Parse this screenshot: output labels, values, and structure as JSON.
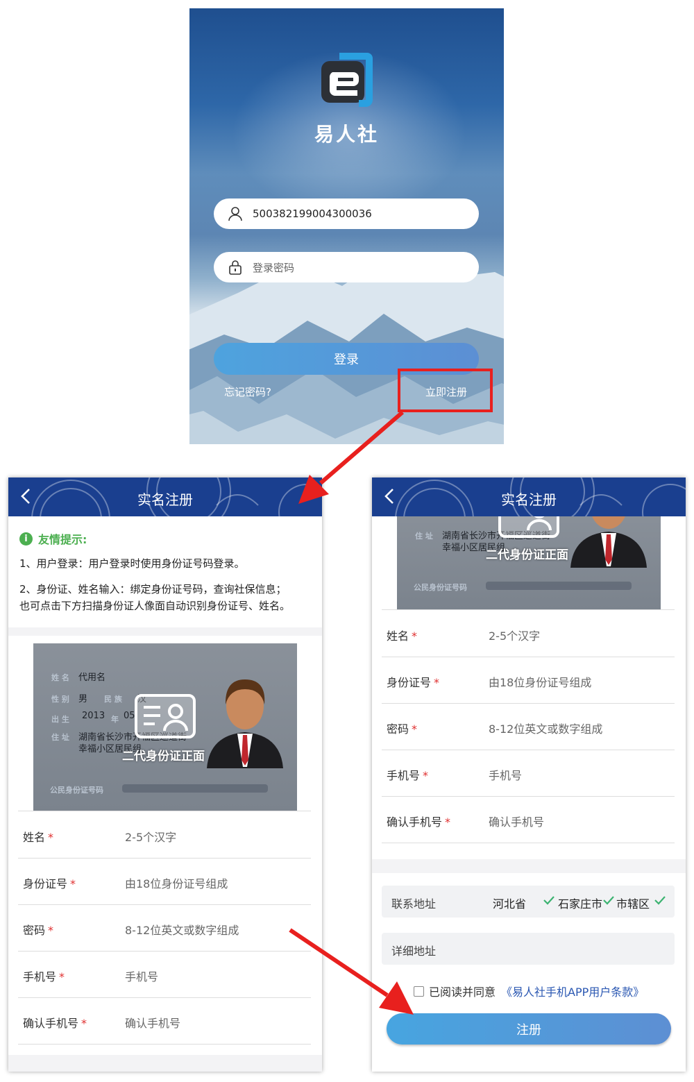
{
  "login": {
    "brand": "易人社",
    "account_value": "500382199004300036",
    "password_placeholder": "登录密码",
    "login_label": "登录",
    "forgot_label": "忘记密码?",
    "register_label": "立即注册"
  },
  "register": {
    "title": "实名注册",
    "tips": {
      "heading": "友情提示:",
      "line1": "1、用户登录：用户登录时使用身份证号码登录。",
      "line2": "2、身份证、姓名输入：绑定身份证号码，查询社保信息；",
      "line3": "也可点击下方扫描身份证人像面自动识别身份证号、姓名。"
    },
    "id_card": {
      "caption": "二代身份证正面",
      "name_label": "姓 名",
      "name_value": "代用名",
      "gender_label": "性 别",
      "gender_value": "男",
      "ethnic_label": "民 族",
      "ethnic_value": "汉",
      "birth_label": "出 生",
      "birth_year": "2013",
      "year_char": "年",
      "birth_month": "05",
      "address_label": "住 址",
      "address_line1": "湖南省长沙市开福区巡道街",
      "address_line2": "幸福小区居民组",
      "idno_label": "公民身份证号码"
    },
    "fields": [
      {
        "label": "姓名",
        "required": "*",
        "placeholder": "2-5个汉字"
      },
      {
        "label": "身份证号",
        "required": "*",
        "placeholder": "由18位身份证号组成"
      },
      {
        "label": "密码",
        "required": "*",
        "placeholder": "8-12位英文或数字组成"
      },
      {
        "label": "手机号",
        "required": "*",
        "placeholder": "手机号"
      },
      {
        "label": "确认手机号",
        "required": "*",
        "placeholder": "确认手机号"
      }
    ],
    "address": {
      "label": "联系地址",
      "province": "河北省",
      "city": "石家庄市",
      "district": "市辖区",
      "detail_placeholder": "详细地址"
    },
    "agreement": {
      "text": "已阅读并同意",
      "link": "《易人社手机APP用户条款》"
    },
    "submit_label": "注册"
  },
  "colors": {
    "header_blue": "#1a3f8f",
    "button_start": "#47a5e0",
    "button_end": "#5d8fd3",
    "required_red": "#e03030",
    "tip_green": "#4caf50",
    "highlight_red": "#e8201e"
  }
}
